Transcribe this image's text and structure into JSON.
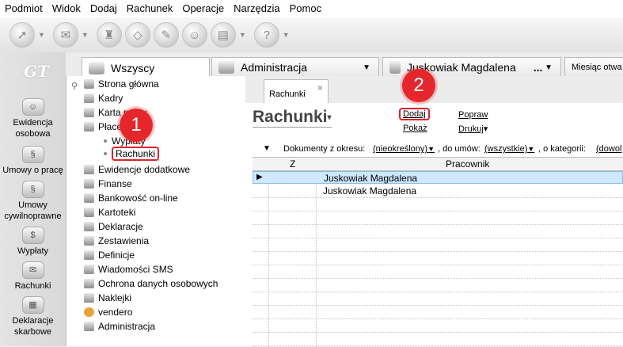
{
  "menu": [
    "Podmiot",
    "Widok",
    "Dodaj",
    "Rachunek",
    "Operacje",
    "Narzędzia",
    "Pomoc"
  ],
  "logo": "GT",
  "left_nav": [
    {
      "label": "Ewidencja osobowa"
    },
    {
      "label": "Umowy o pracę"
    },
    {
      "label": "Umowy cywilnoprawne"
    },
    {
      "label": "Wypłaty"
    },
    {
      "label": "Rachunki"
    },
    {
      "label": "Deklaracje skarbowe"
    }
  ],
  "tabs": {
    "all": "Wszyscy",
    "admin": "Administracja",
    "user": "Juskowiak Magdalena",
    "user_more": "...",
    "month": "Miesiąc otwa"
  },
  "tree": [
    {
      "label": "Strona główna"
    },
    {
      "label": "Kadry"
    },
    {
      "label": "Karta pracy"
    },
    {
      "label": "Płace"
    },
    {
      "label": "Ewidencje dodatkowe"
    },
    {
      "label": "Finanse"
    },
    {
      "label": "Bankowość on-line"
    },
    {
      "label": "Kartoteki"
    },
    {
      "label": "Deklaracje"
    },
    {
      "label": "Zestawienia"
    },
    {
      "label": "Definicje"
    },
    {
      "label": "Wiadomości SMS"
    },
    {
      "label": "Ochrona danych osobowych"
    },
    {
      "label": "Naklejki"
    },
    {
      "label": "vendero"
    },
    {
      "label": "Administracja"
    }
  ],
  "tree_sub": {
    "wyplaty": "Wypłaty",
    "rachunki": "Rachunki"
  },
  "badges": {
    "one": "1",
    "two": "2"
  },
  "doc_tab": {
    "label": "Rachunki",
    "close": "×"
  },
  "header": {
    "title": "Rachunki",
    "caret": "▾"
  },
  "actions": {
    "dodaj": "Dodaj",
    "pokaz": "Pokaż",
    "popraw": "Popraw",
    "drukuj": "Drukuj",
    "drukuj_caret": "▾"
  },
  "filter": {
    "arrow": "▼",
    "label1": "Dokumenty z okresu:",
    "val1": "(nieokreślony)",
    "label2": ", do umów:",
    "val2": "(wszystkie)",
    "label3": ", o kategorii:",
    "val3": "(dowol"
  },
  "grid": {
    "col_z": "Z",
    "col_pracownik": "Pracownik",
    "rows": [
      {
        "marker": "▶",
        "pracownik": "Juskowiak Magdalena"
      },
      {
        "marker": "",
        "pracownik": "Juskowiak Magdalena"
      }
    ]
  },
  "colors": {
    "highlight": "#e0202a",
    "badge": "#e5272d",
    "selected_row": "#cde8ff"
  }
}
